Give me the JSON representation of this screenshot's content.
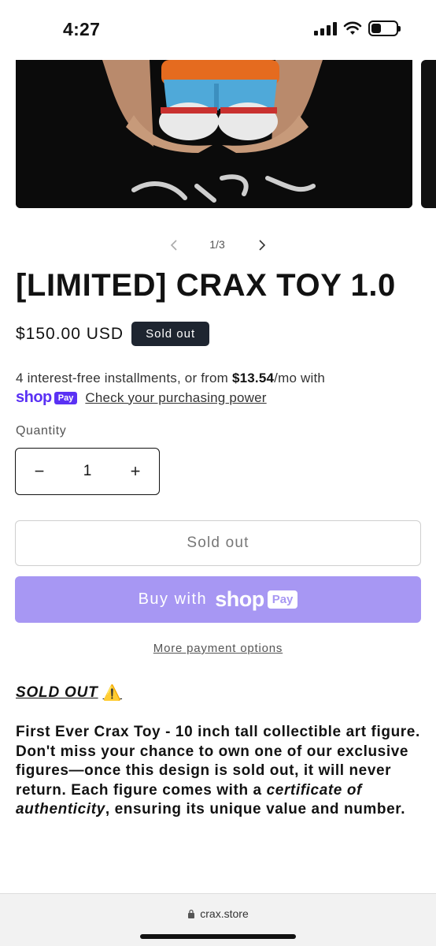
{
  "status_bar": {
    "time": "4:27"
  },
  "gallery": {
    "counter": "1/3",
    "image_caption": "浪"
  },
  "product": {
    "title": "[LIMITED] CRAX TOY 1.0",
    "price": "$150.00 USD",
    "badge": "Sold out"
  },
  "installments": {
    "text_before": "4 interest-free installments, or from ",
    "amount": "$13.54",
    "text_after": "/mo with",
    "shop_word": "shop",
    "pay_word": "Pay",
    "link": "Check your purchasing power"
  },
  "quantity": {
    "label": "Quantity",
    "value": "1",
    "minus": "−",
    "plus": "+"
  },
  "buttons": {
    "sold_out": "Sold out",
    "buy_with": "Buy with",
    "buy_shop": "shop",
    "buy_pay": "Pay",
    "more_options": "More payment options"
  },
  "description": {
    "heading": "SOLD OUT",
    "heading_icon": "⚠️",
    "part1": "First Ever Crax Toy - 10 inch tall collectible art figure. Don't miss your chance to own one of our exclusive figures—once this design is sold out, it will never return. Each figure comes with a ",
    "emphasis": "certificate of authenticity",
    "part2": ", ensuring its unique value and number."
  },
  "browser": {
    "url": "crax.store"
  },
  "colors": {
    "shop_pay": "#5a31f4",
    "buy_button": "#a797f3",
    "badge": "#1e2530"
  }
}
